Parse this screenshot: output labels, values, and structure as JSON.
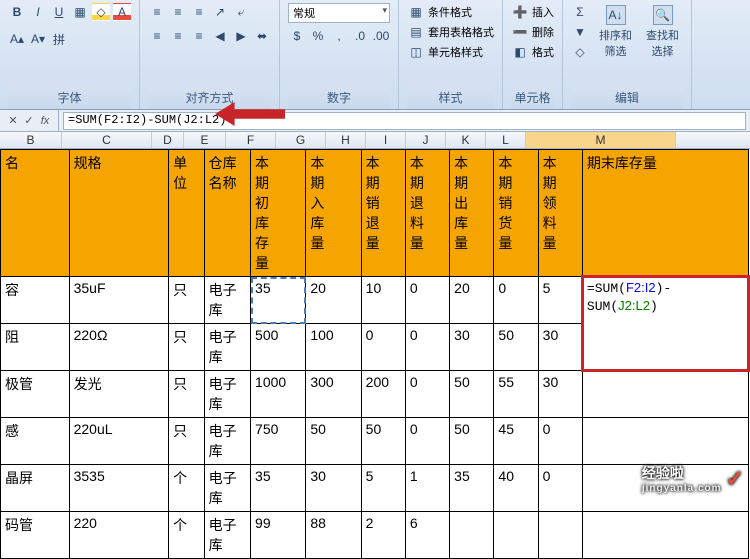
{
  "ribbon": {
    "font": {
      "label": "字体"
    },
    "align": {
      "label": "对齐方式"
    },
    "number": {
      "label": "数字",
      "format": "常规"
    },
    "style": {
      "label": "样式",
      "cond": "条件格式",
      "tbl": "套用表格格式",
      "cell": "单元格样式"
    },
    "cells": {
      "label": "单元格",
      "ins": "插入",
      "del": "删除",
      "fmt": "格式"
    },
    "editing": {
      "label": "编辑",
      "sort": "排序和\n筛选",
      "find": "查找和\n选择"
    }
  },
  "formula": "=SUM(F2:I2)-SUM(J2:L2)",
  "cols": [
    "B",
    "C",
    "D",
    "E",
    "F",
    "G",
    "H",
    "I",
    "J",
    "K",
    "L",
    "M"
  ],
  "headers": [
    "名",
    "规格",
    "单\n位",
    "仓库\n名称",
    "本\n期\n初\n库\n存\n量",
    "本\n期\n入\n库\n量",
    "本\n期\n销\n退\n量",
    "本\n期\n退\n料\n量",
    "本\n期\n出\n库\n量",
    "本\n期\n销\n货\n量",
    "本\n期\n领\n料\n量",
    "期末库存量"
  ],
  "rows": [
    {
      "b": "容",
      "c": "35uF",
      "d": "只",
      "e": "电子\n库",
      "f": "35",
      "g": "20",
      "h": "10",
      "i": "0",
      "j": "20",
      "k": "0",
      "l": "5",
      "mFormula": true
    },
    {
      "b": "阻",
      "c": "220Ω",
      "d": "只",
      "e": "电子\n库",
      "f": "500",
      "g": "100",
      "h": "0",
      "i": "0",
      "j": "30",
      "k": "50",
      "l": "30",
      "m": ""
    },
    {
      "b": "极管",
      "c": "发光",
      "d": "只",
      "e": "电子\n库",
      "f": "1000",
      "g": "300",
      "h": "200",
      "i": "0",
      "j": "50",
      "k": "55",
      "l": "30",
      "m": ""
    },
    {
      "b": "感",
      "c": "220uL",
      "d": "只",
      "e": "电子\n库",
      "f": "750",
      "g": "50",
      "h": "50",
      "i": "0",
      "j": "50",
      "k": "45",
      "l": "0",
      "m": ""
    },
    {
      "b": "晶屏",
      "c": "3535",
      "d": "个",
      "e": "电子\n库",
      "f": "35",
      "g": "30",
      "h": "5",
      "i": "1",
      "j": "35",
      "k": "40",
      "l": "0",
      "m": ""
    },
    {
      "b": "码管",
      "c": "220",
      "d": "个",
      "e": "电子\n库",
      "f": "99",
      "g": "88",
      "h": "2",
      "i": "6",
      "j": "",
      "k": "",
      "l": "",
      "m": ""
    }
  ],
  "cellFormula": {
    "p1": "=SUM(",
    "r1": "F2:I2",
    "p2": ")-\nSUM(",
    "r2": "J2:L2",
    "p3": ")"
  },
  "watermark": {
    "t": "经验啦",
    "u": "jingyanla.com"
  }
}
